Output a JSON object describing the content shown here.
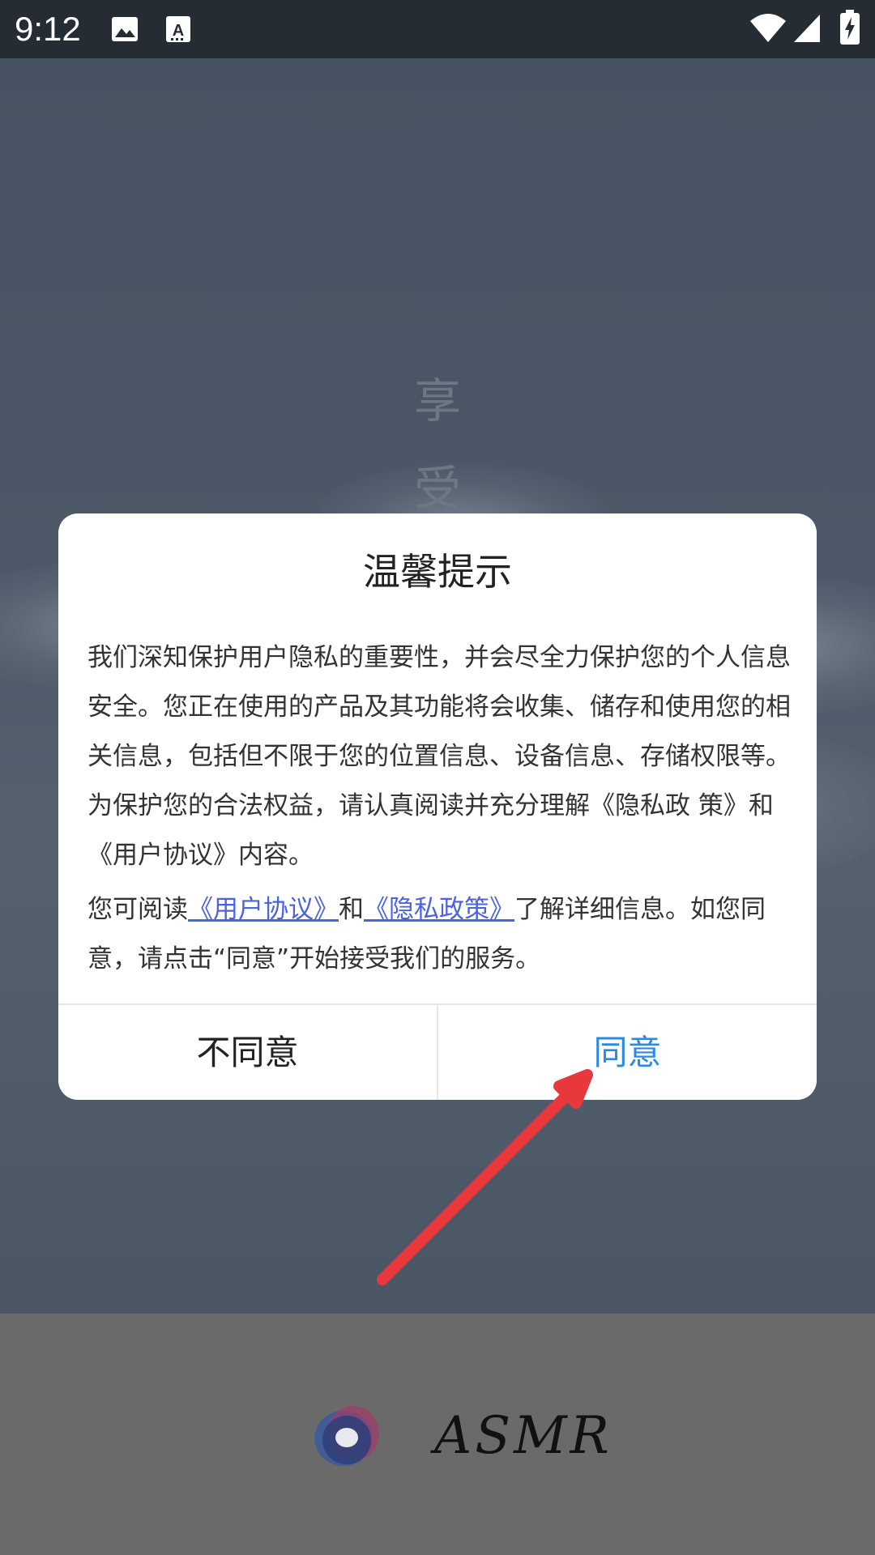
{
  "status_bar": {
    "time": "9:12",
    "icons": [
      "image-icon",
      "text-recognition-icon",
      "wifi-icon",
      "cellular-signal-icon",
      "battery-charging-icon"
    ]
  },
  "background": {
    "vertical_text": [
      "享",
      "受"
    ],
    "brand": "ASMR"
  },
  "dialog": {
    "title": "温馨提示",
    "paragraph1": "我们深知保护用户隐私的重要性，并会尽全力保护您的个人信息安全。您正在使用的产品及其功能将会收集、储存和使用您的相关信息，包括但不限于您的位置信息、设备信息、存储权限等。为保护您的合法权益，请认真阅读并充分理解《隐私政 策》和《用户协议》内容。",
    "paragraph2": {
      "prefix": "您可阅读",
      "link_user_agreement": "《用户协议》",
      "connector": "和",
      "link_privacy_policy": "《隐私政策》",
      "suffix": "了解详细信息。如您同意，请点击“同意”开始接受我们的服务。"
    },
    "disagree_label": "不同意",
    "agree_label": "同意"
  },
  "colors": {
    "accent_agree": "#2a8be6",
    "link": "#4a63e0",
    "annotation_arrow": "#e8383d"
  }
}
